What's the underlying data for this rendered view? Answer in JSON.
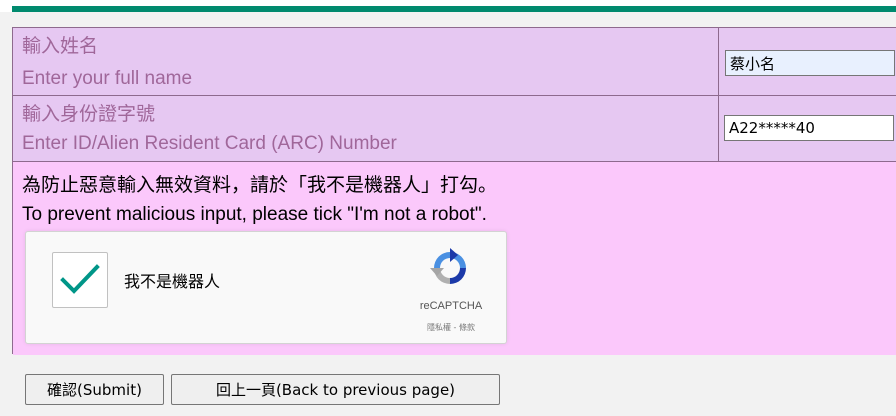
{
  "name_row": {
    "label_zh": "輸入姓名",
    "label_en": "Enter your full name",
    "value": "蔡小名"
  },
  "id_row": {
    "label_zh": "輸入身份證字號",
    "label_en": "Enter ID/Alien Resident Card (ARC) Number",
    "value": "A22*****40"
  },
  "captcha_row": {
    "instruction_zh": "為防止惡意輸入無效資料，請於「我不是機器人」打勾。",
    "instruction_en": "To prevent malicious input, please tick \"I'm not a robot\"."
  },
  "recaptcha": {
    "label": "我不是機器人",
    "brand": "reCAPTCHA",
    "terms": "隱私權 - 條款",
    "checked": true,
    "checkmark_color": "#009688"
  },
  "buttons": {
    "submit": "確認(Submit)",
    "back": "回上一頁(Back to previous page)"
  },
  "colors": {
    "header_stripe": "#008a6e",
    "label_text": "#a0679a",
    "input_row_bg": "#e6c8f2",
    "captcha_row_bg": "#fbc8fb"
  }
}
